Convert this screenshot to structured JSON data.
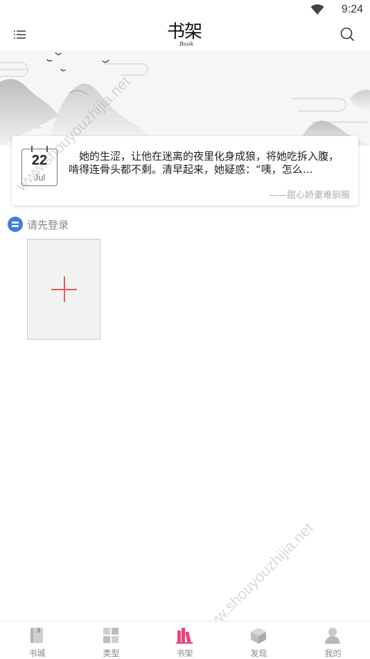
{
  "status_bar": {
    "time": "9:24"
  },
  "header": {
    "title": "书架",
    "title_sub": "Book"
  },
  "quote": {
    "day": "22",
    "month": "Jul",
    "text": "她的生涩，让他在迷离的夜里化身成狼，将她吃拆入腹，啃得连骨头都不剩。清早起来，她疑惑：“咦，怎么…",
    "source": "——甜心娇妻难驯服"
  },
  "login": {
    "label": "请先登录"
  },
  "add_book": {
    "icon": "plus-icon"
  },
  "watermark": "www.shouyouzhijia.net",
  "tabs": [
    {
      "label": "书城",
      "icon": "book-icon"
    },
    {
      "label": "类型",
      "icon": "grid-icon"
    },
    {
      "label": "书架",
      "icon": "bookshelf-icon",
      "active": true,
      "color": "#e8457a"
    },
    {
      "label": "发现",
      "icon": "cube-icon"
    },
    {
      "label": "我的",
      "icon": "user-icon"
    }
  ]
}
